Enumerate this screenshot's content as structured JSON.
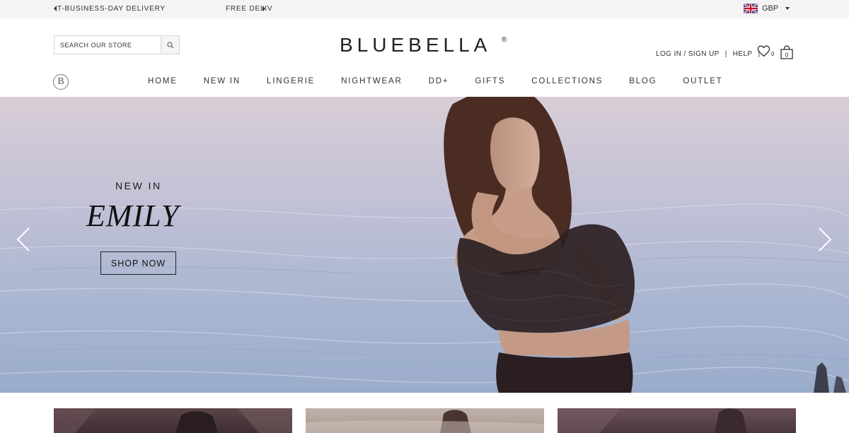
{
  "promo": {
    "message_1": "T-BUSINESS-DAY DELIVERY",
    "message_2": "FREE DELIV"
  },
  "currency": {
    "code": "GBP",
    "flag_icon": "uk-flag-icon"
  },
  "search": {
    "placeholder": "SEARCH OUR STORE",
    "button_icon": "search-icon"
  },
  "brand": {
    "logo": "BLUEBELLA",
    "registered": "®",
    "monogram": "B"
  },
  "account": {
    "login_label": "LOG IN / SIGN UP",
    "separator": "|",
    "help_label": "HELP",
    "wishlist_count": "0",
    "bag_count": "0"
  },
  "nav": {
    "items": [
      "HOME",
      "NEW IN",
      "LINGERIE",
      "NIGHTWEAR",
      "DD+",
      "GIFTS",
      "COLLECTIONS",
      "BLOG",
      "OUTLET"
    ]
  },
  "hero": {
    "eyebrow": "NEW IN",
    "title": "EMILY",
    "cta_label": "SHOP NOW",
    "prev_icon": "chevron-left-icon",
    "next_icon": "chevron-right-icon"
  },
  "colors": {
    "text": "#222222",
    "promo_bg": "#f4f4f4",
    "border": "#d6d6d6"
  }
}
